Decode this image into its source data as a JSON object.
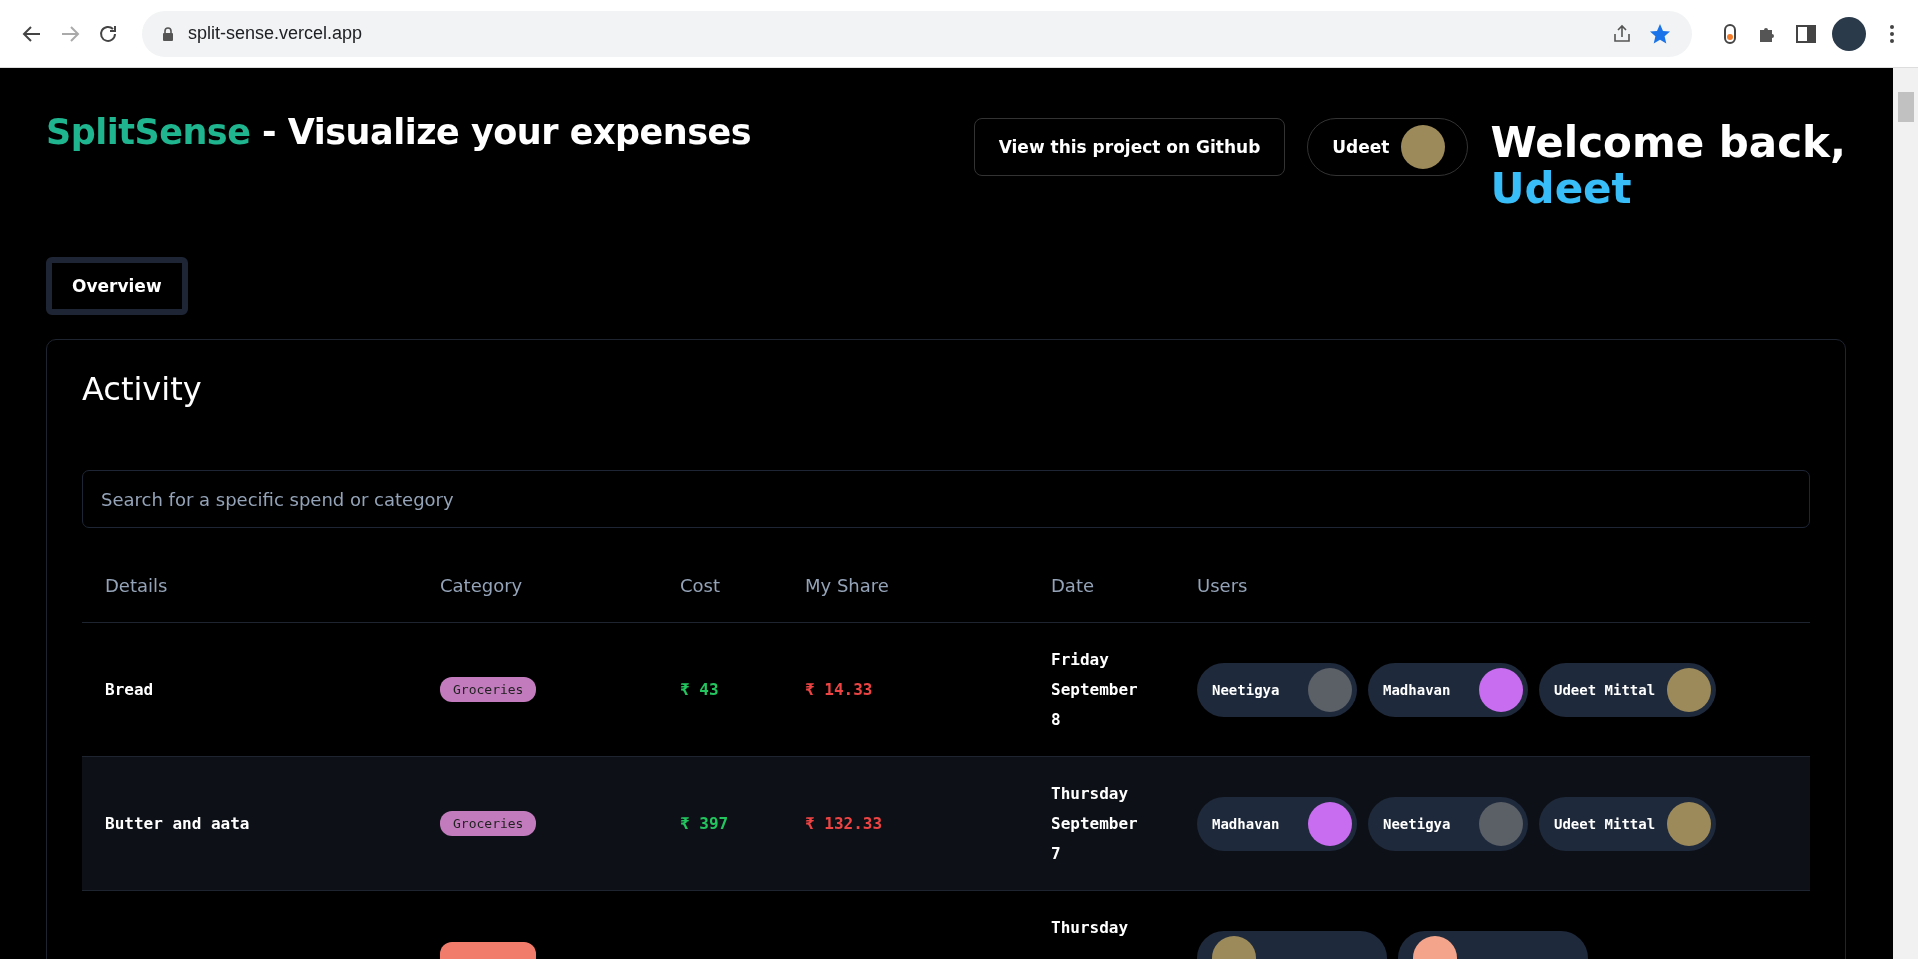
{
  "browser": {
    "url": "split-sense.vercel.app",
    "bookmarked": true
  },
  "header": {
    "brand": "SplitSense",
    "tagline": " - Visualize your expenses",
    "github_button": "View this project on Github",
    "user_button": "Udeet",
    "welcome": "Welcome back,",
    "welcome_name": "Udeet"
  },
  "tabs": [
    {
      "label": "Overview",
      "selected": true
    }
  ],
  "activity": {
    "title": "Activity",
    "search": {
      "placeholder": "Search for a specific spend or category"
    },
    "columns": [
      "Details",
      "Category",
      "Cost",
      "My Share",
      "Date",
      "Users"
    ],
    "rows": [
      {
        "details": "Bread",
        "category": {
          "label": "Groceries",
          "color": "#c27bbd"
        },
        "cost": "₹ 43",
        "share": "₹ 14.33",
        "date": "Friday September 8",
        "highlighted": false,
        "users": [
          {
            "name": "Neetigya",
            "color": "#5b5f66"
          },
          {
            "name": "Madhavan",
            "color": "#c86cf0"
          },
          {
            "name": "Udeet Mittal",
            "color": "#9c8a5a"
          }
        ]
      },
      {
        "details": "Butter and aata",
        "category": {
          "label": "Groceries",
          "color": "#c27bbd"
        },
        "cost": "₹ 397",
        "share": "₹ 132.33",
        "date": "Thursday September 7",
        "highlighted": true,
        "users": [
          {
            "name": "Madhavan",
            "color": "#c86cf0"
          },
          {
            "name": "Neetigya",
            "color": "#5b5f66"
          },
          {
            "name": "Udeet Mittal",
            "color": "#9c8a5a"
          }
        ]
      },
      {
        "category": {
          "color": "#f27c6c"
        },
        "date": "Thursday",
        "highlighted": false,
        "users": [
          {
            "color": "#9c8a5a"
          },
          {
            "color": "#f4a48a"
          }
        ]
      }
    ]
  }
}
